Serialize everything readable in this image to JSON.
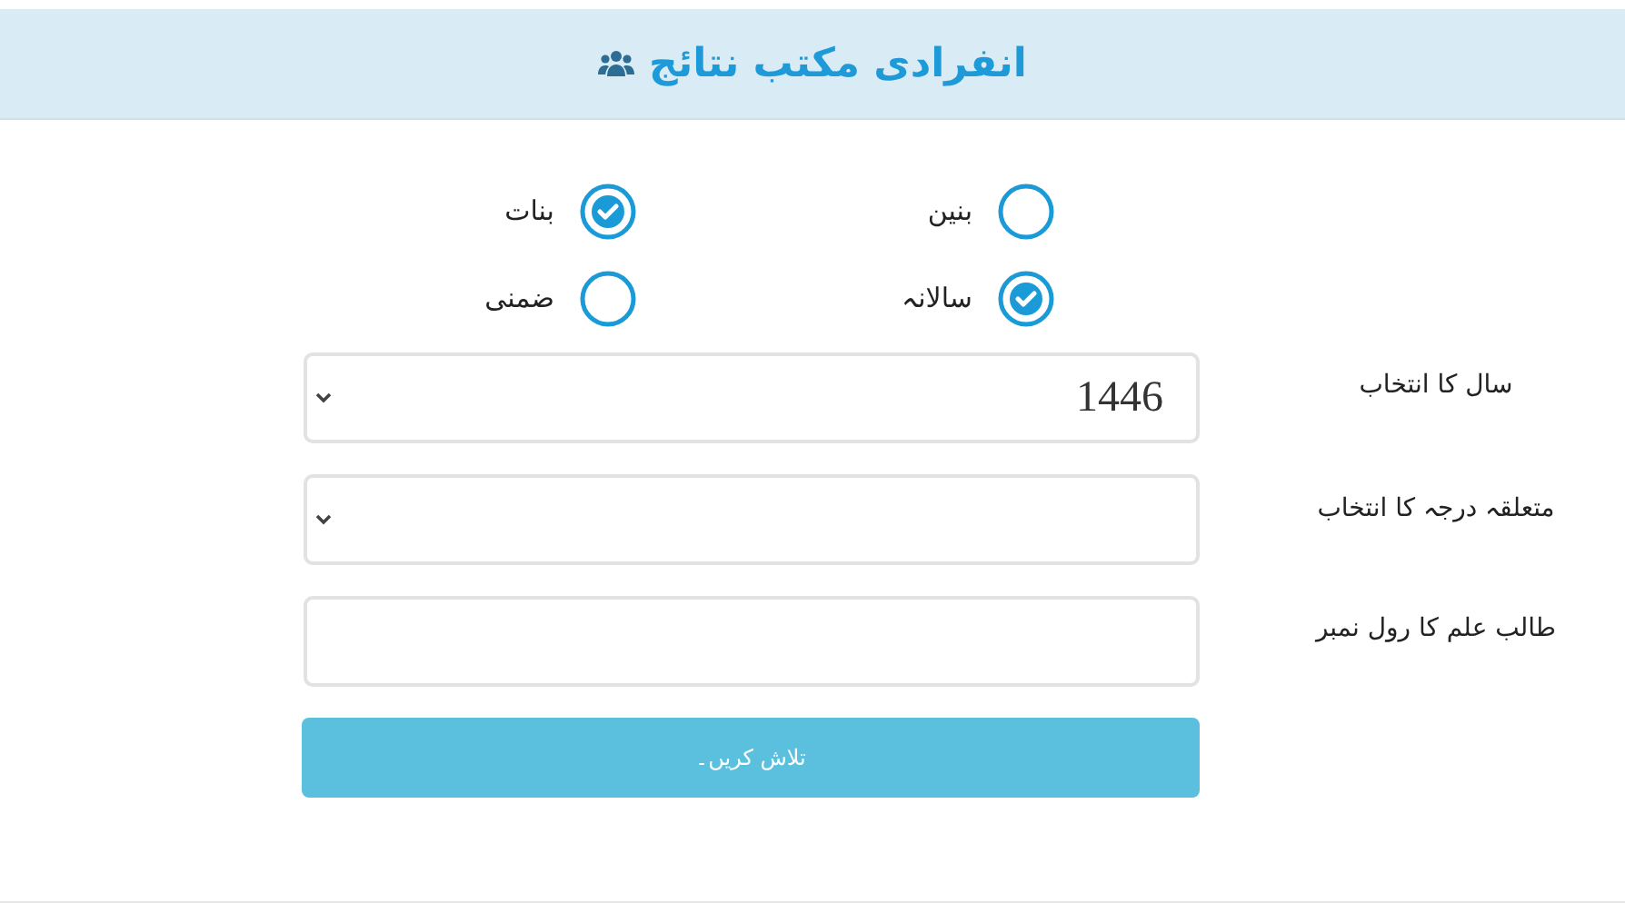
{
  "header": {
    "title": "انفرادی مکتب نتائج"
  },
  "gender_options": [
    {
      "label": "بنین",
      "selected": false
    },
    {
      "label": "بنات",
      "selected": true
    }
  ],
  "exam_options": [
    {
      "label": "سالانہ",
      "selected": true
    },
    {
      "label": "ضمنی",
      "selected": false
    }
  ],
  "fields": [
    {
      "label": "سال کا انتخاب",
      "kind": "select",
      "value": "1446"
    },
    {
      "label": "متعلقہ درجہ کا انتخاب",
      "kind": "select"
    },
    {
      "label": "طالب علم کا رول نمبر",
      "kind": "text"
    }
  ],
  "search_button": {
    "label": "تلاش کریں۔"
  }
}
